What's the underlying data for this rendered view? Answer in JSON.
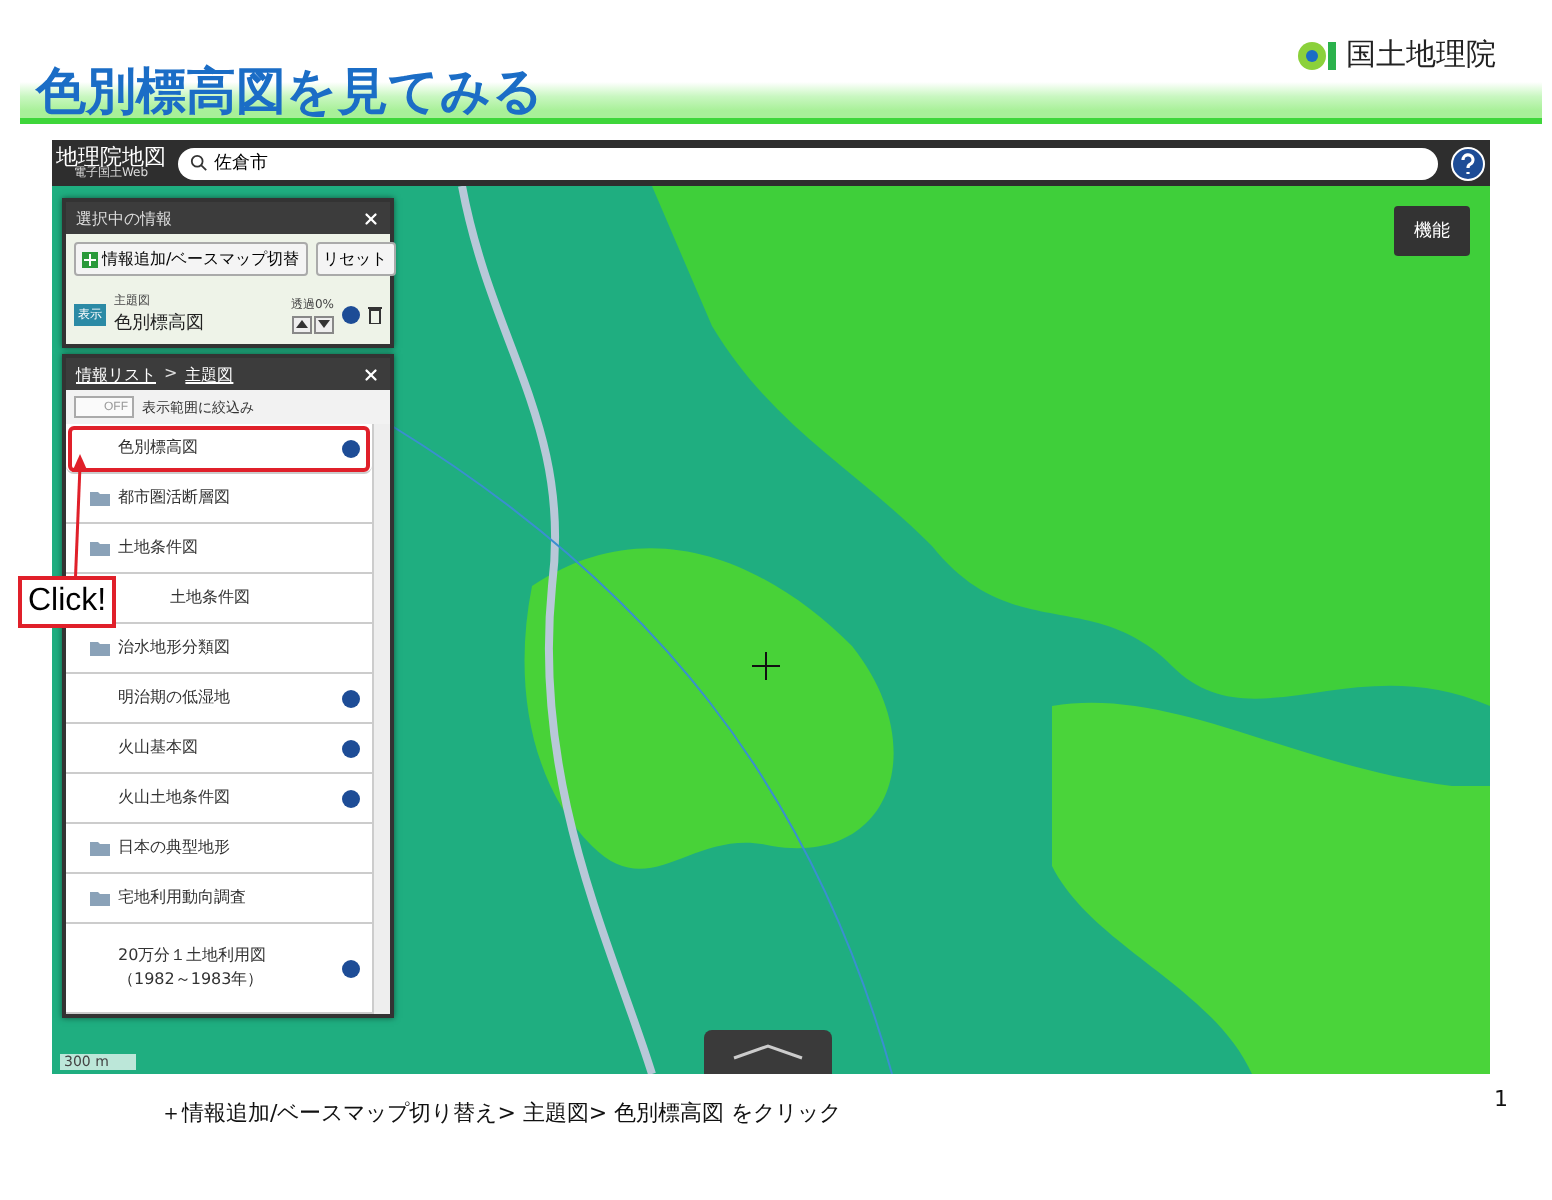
{
  "title": "色別標高図を見てみる",
  "logo": {
    "text": "国土地理院"
  },
  "map": {
    "app_name": "地理院地図",
    "app_subtitle": "電子国土Web",
    "search": {
      "value": "佐倉市"
    },
    "function_button": "機能",
    "scale": "300 m"
  },
  "selected_panel": {
    "title": "選択中の情報",
    "add_button": "情報追加/ベースマップ切替",
    "reset_button": "リセット",
    "layer": {
      "badge": "表示",
      "category": "主題図",
      "name": "色別標高図",
      "opacity": "透過0%"
    }
  },
  "list_panel": {
    "breadcrumb_link": "情報リスト",
    "separator": ">",
    "current": "主題図",
    "filter": {
      "toggle": "OFF",
      "on": false,
      "label": "表示範囲に絞込み"
    },
    "items": [
      {
        "kind": "layer",
        "label": "色別標高図",
        "highlighted": true
      },
      {
        "kind": "folder",
        "label": "都市圏活断層図",
        "highlighted": false
      },
      {
        "kind": "folder",
        "label": "土地条件図",
        "highlighted": false
      },
      {
        "kind": "covered",
        "label": "土地条件図",
        "highlighted": false
      },
      {
        "kind": "folder",
        "label": "治水地形分類図",
        "highlighted": false
      },
      {
        "kind": "layer",
        "label": "明治期の低湿地",
        "highlighted": false
      },
      {
        "kind": "layer",
        "label": "火山基本図",
        "highlighted": false
      },
      {
        "kind": "layer",
        "label": "火山土地条件図",
        "highlighted": false
      },
      {
        "kind": "folder",
        "label": "日本の典型地形",
        "highlighted": false
      },
      {
        "kind": "folder",
        "label": "宅地利用動向調査",
        "highlighted": false
      },
      {
        "kind": "layer",
        "label": "20万分１土地利用図",
        "sublabel": "（1982～1983年）",
        "highlighted": false
      }
    ]
  },
  "callout": {
    "text": "Click!"
  },
  "caption": "＋情報追加/ベースマップ切り替え> 主題図> 色別標高図  をクリック",
  "page_number": "1"
}
